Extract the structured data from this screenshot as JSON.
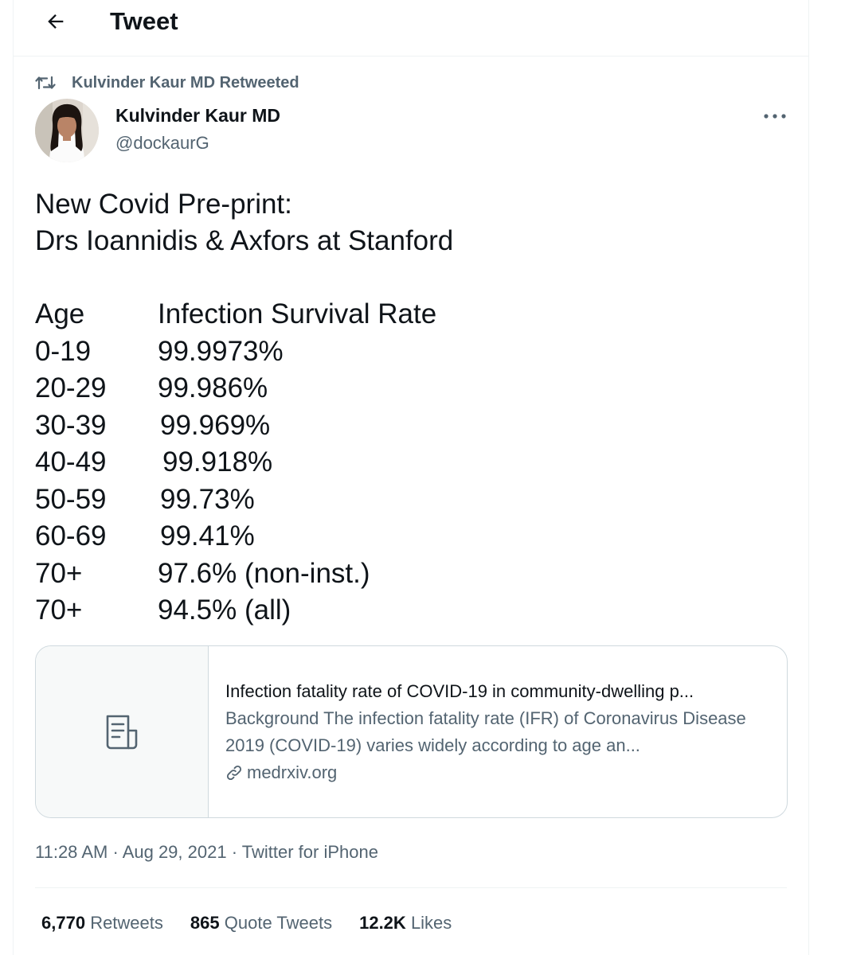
{
  "header": {
    "title": "Tweet",
    "back_icon": "arrow-left-icon"
  },
  "retweet_context": {
    "text": "Kulvinder Kaur MD Retweeted",
    "icon": "retweet-icon"
  },
  "author": {
    "name": "Kulvinder Kaur MD",
    "handle": "@dockaurG"
  },
  "tweet": {
    "lines": [
      "New Covid Pre-print:",
      "Drs Ioannidis & Axfors at Stanford"
    ],
    "table_header": {
      "age": "Age",
      "rate": "Infection Survival Rate"
    },
    "rows": [
      {
        "age": "0-19",
        "rate": "99.9973%"
      },
      {
        "age": "20-29",
        "rate": "99.986%"
      },
      {
        "age": "30-39",
        "rate": "99.969%"
      },
      {
        "age": "40-49",
        "rate": "99.918%"
      },
      {
        "age": "50-59",
        "rate": "99.73%"
      },
      {
        "age": "60-69",
        "rate": "99.41%"
      },
      {
        "age": "70+",
        "rate": "97.6% (non-inst.)"
      },
      {
        "age": "70+",
        "rate": "94.5% (all)"
      }
    ]
  },
  "link_card": {
    "title": "Infection fatality rate of COVID-19 in community-dwelling p...",
    "description": "Background The infection fatality rate (IFR) of Coronavirus Disease 2019 (COVID-19) varies widely according to age an...",
    "domain": "medrxiv.org"
  },
  "meta": {
    "time": "11:28 AM",
    "date": "Aug 29, 2021",
    "source": "Twitter for iPhone",
    "separator": "·"
  },
  "stats": {
    "retweets": {
      "count": "6,770",
      "label": "Retweets"
    },
    "quotes": {
      "count": "865",
      "label": "Quote Tweets"
    },
    "likes": {
      "count": "12.2K",
      "label": "Likes"
    }
  },
  "colors": {
    "text": "#0f1419",
    "secondary": "#536471",
    "border": "#cfd9de",
    "divider": "#eff3f4"
  }
}
